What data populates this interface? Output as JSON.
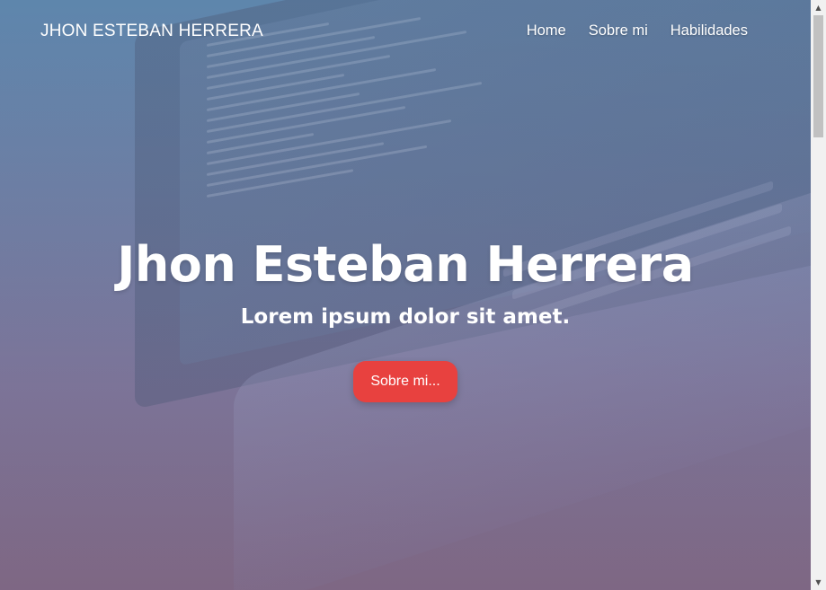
{
  "navbar": {
    "brand": "JHON ESTEBAN HERRERA",
    "links": [
      {
        "label": "Home"
      },
      {
        "label": "Sobre mi"
      },
      {
        "label": "Habilidades"
      }
    ]
  },
  "hero": {
    "title": "Jhon Esteban Herrera",
    "subtitle": "Lorem ipsum dolor sit amet.",
    "button_label": "Sobre mi..."
  },
  "colors": {
    "accent_button": "#e8413f",
    "hero_top": "#5f87ad",
    "hero_bottom": "#7f6a86",
    "text": "#ffffff"
  },
  "icons": {
    "scroll_up": "triangle-up-icon",
    "scroll_down": "triangle-down-icon"
  }
}
